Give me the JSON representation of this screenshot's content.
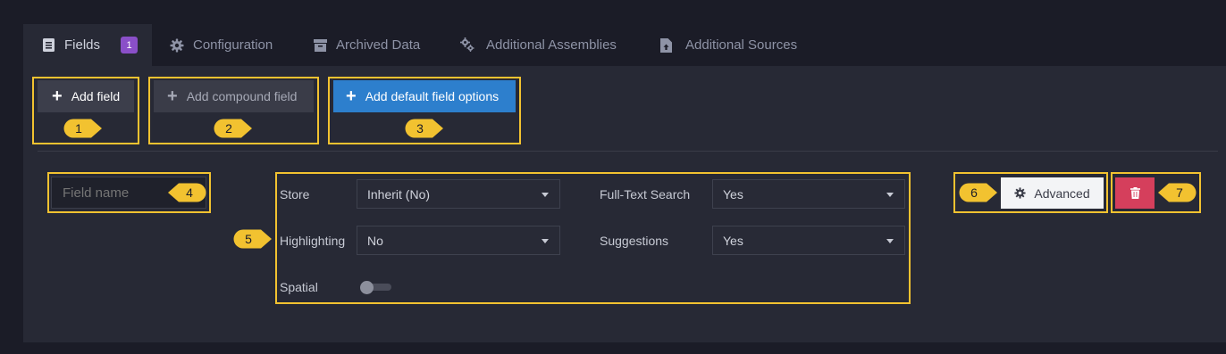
{
  "tabs": [
    {
      "label": "Fields",
      "icon": "list-icon",
      "badge": "1",
      "active": true
    },
    {
      "label": "Configuration",
      "icon": "gear-icon"
    },
    {
      "label": "Archived Data",
      "icon": "archive-icon"
    },
    {
      "label": "Additional Assemblies",
      "icon": "gears-icon"
    },
    {
      "label": "Additional Sources",
      "icon": "file-upload-icon"
    }
  ],
  "toolbar": {
    "add_field": "Add field",
    "add_compound_field": "Add compound field",
    "add_default_field_options": "Add default field options"
  },
  "field": {
    "name_placeholder": "Field name",
    "store_label": "Store",
    "store_value": "Inherit (No)",
    "fulltext_label": "Full-Text Search",
    "fulltext_value": "Yes",
    "highlighting_label": "Highlighting",
    "highlighting_value": "No",
    "suggestions_label": "Suggestions",
    "suggestions_value": "Yes",
    "spatial_label": "Spatial",
    "spatial_enabled": false,
    "advanced_label": "Advanced"
  },
  "callouts": [
    "1",
    "2",
    "3",
    "4",
    "5",
    "6",
    "7"
  ],
  "colors": {
    "page_bg": "#1b1c27",
    "panel_bg": "#272935",
    "accent_blue": "#2d7fcd",
    "delete_red": "#d53f5c",
    "badge_purple": "#8a4fc8",
    "highlight_yellow": "#f2c230"
  }
}
